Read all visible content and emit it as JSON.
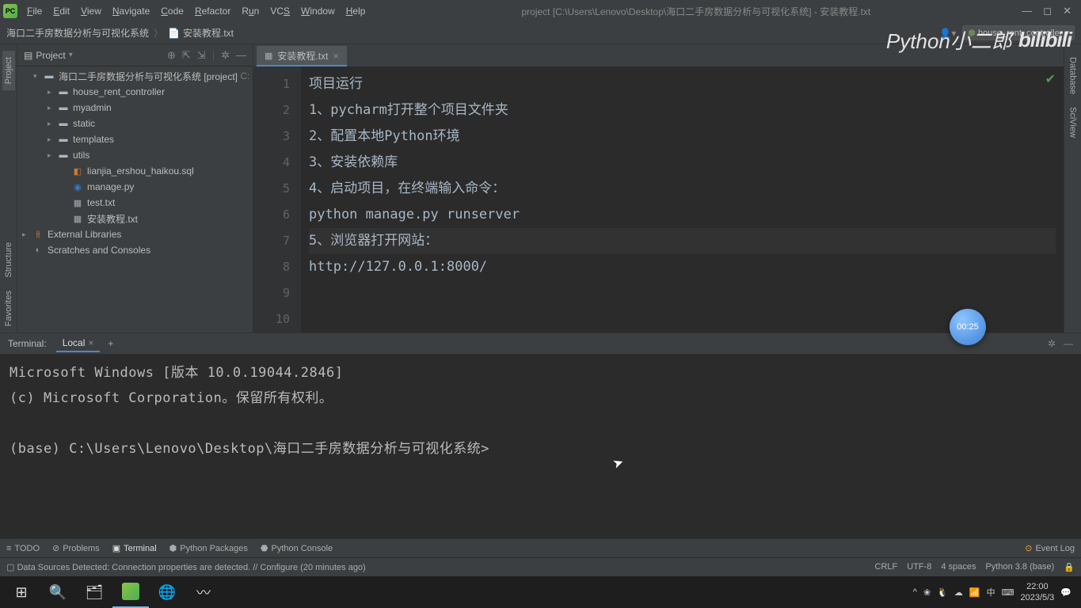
{
  "titlebar": {
    "logo": "PC",
    "menus": [
      "File",
      "Edit",
      "View",
      "Navigate",
      "Code",
      "Refactor",
      "Run",
      "VCS",
      "Window",
      "Help"
    ],
    "title": "project [C:\\Users\\Lenovo\\Desktop\\海口二手房数据分析与可视化系统] - 安装教程.txt"
  },
  "navbar": {
    "crumb1": "海口二手房数据分析与可视化系统",
    "crumb2": "安装教程.txt",
    "config": "house_rent_controller"
  },
  "left_tabs": {
    "project": "Project",
    "structure": "Structure",
    "favorites": "Favorites"
  },
  "right_tabs": {
    "database": "Database",
    "sciview": "SciView"
  },
  "project_panel": {
    "title": "Project",
    "tree": {
      "root": "海口二手房数据分析与可视化系统 [project]",
      "root_suffix": "C:",
      "items": [
        {
          "label": "house_rent_controller",
          "type": "folder"
        },
        {
          "label": "myadmin",
          "type": "folder"
        },
        {
          "label": "static",
          "type": "folder"
        },
        {
          "label": "templates",
          "type": "folder"
        },
        {
          "label": "utils",
          "type": "folder"
        },
        {
          "label": "lianjia_ershou_haikou.sql",
          "type": "sql"
        },
        {
          "label": "manage.py",
          "type": "py"
        },
        {
          "label": "test.txt",
          "type": "txt"
        },
        {
          "label": "安装教程.txt",
          "type": "txt"
        }
      ],
      "external": "External Libraries",
      "scratches": "Scratches and Consoles"
    }
  },
  "editor": {
    "tab": "安装教程.txt",
    "lines": [
      "项目运行",
      "1、pycharm打开整个项目文件夹",
      "2、配置本地Python环境",
      "3、安装依赖库",
      "4、启动项目，在终端输入命令：",
      "python manage.py runserver",
      "5、浏览器打开网站：",
      "http://127.0.0.1:8000/",
      "",
      ""
    ],
    "current_line": 7,
    "line_count": 10
  },
  "terminal": {
    "label": "Terminal:",
    "tab": "Local",
    "lines": [
      "Microsoft Windows [版本 10.0.19044.2846]",
      "(c) Microsoft Corporation。保留所有权利。",
      "",
      "(base) C:\\Users\\Lenovo\\Desktop\\海口二手房数据分析与可视化系统>"
    ]
  },
  "bottom_tools": {
    "todo": "TODO",
    "problems": "Problems",
    "terminal": "Terminal",
    "packages": "Python Packages",
    "console": "Python Console",
    "eventlog": "Event Log"
  },
  "status": {
    "message": "Data Sources Detected: Connection properties are detected. // Configure (20 minutes ago)",
    "crlf": "CRLF",
    "encoding": "UTF-8",
    "indent": "4 spaces",
    "python": "Python 3.8 (base)"
  },
  "taskbar": {
    "time": "22:00",
    "date": "2023/5/3",
    "ime": "中"
  },
  "watermark": {
    "text": "Python小二郎",
    "brand": "bilibili"
  },
  "timer": "00:25"
}
